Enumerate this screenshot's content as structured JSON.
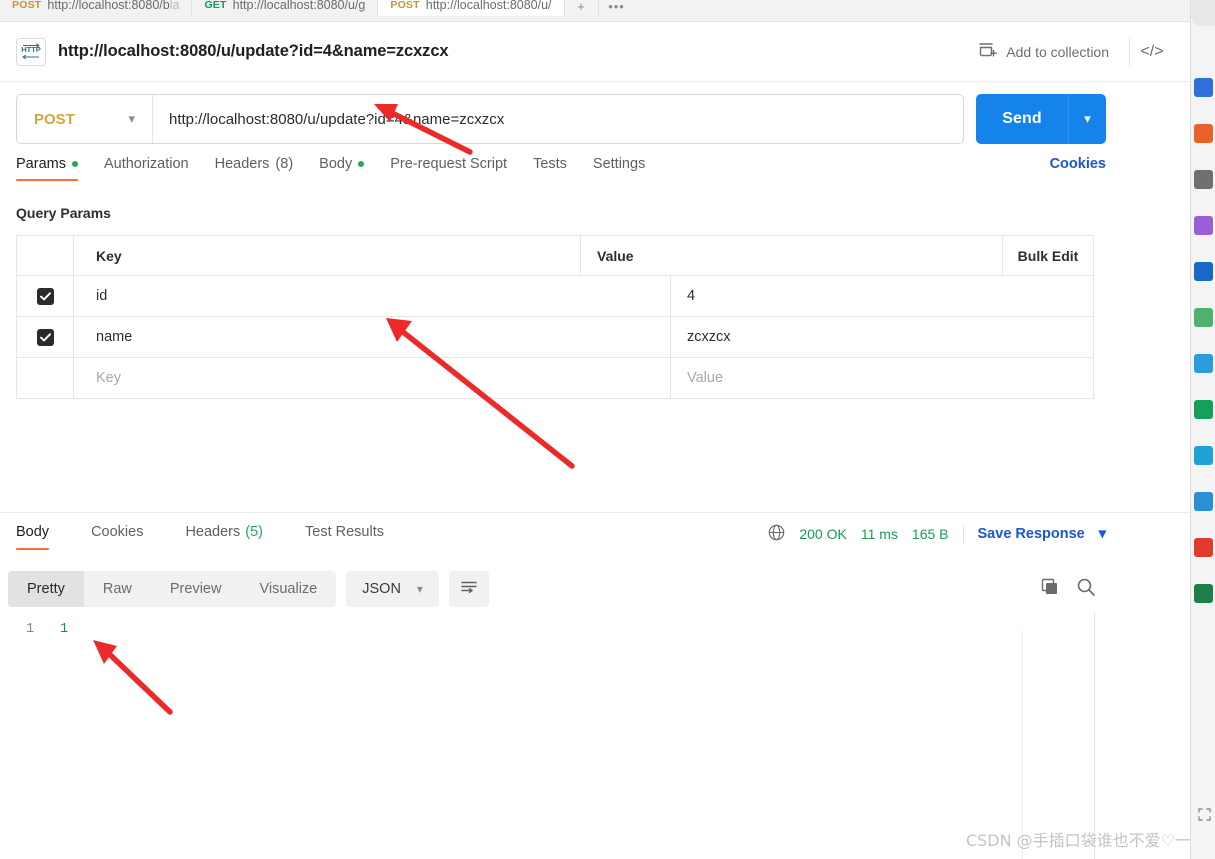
{
  "window_tabs": [
    {
      "method": "POST",
      "url": "http://localhost:8080/b",
      "url_faded": "la",
      "active": false
    },
    {
      "method": "GET",
      "url": "http://localhost:8080/u/g",
      "url_faded": "",
      "active": false
    },
    {
      "method": "POST",
      "url": "http://localhost:8080/u/",
      "url_faded": "",
      "active": true
    }
  ],
  "tab_controls": {
    "plus": "+",
    "more": "•••"
  },
  "request": {
    "icon_label": "HTTP",
    "title": "http://localhost:8080/u/update?id=4&name=zcxzcx",
    "add_to_collection": "Add to collection",
    "code_icon": "</>",
    "method": "POST",
    "url": "http://localhost:8080/u/update?id=4&name=zcxzcx",
    "send_label": "Send"
  },
  "request_tabs": [
    {
      "label": "Params",
      "dot": true,
      "count": "",
      "active": true
    },
    {
      "label": "Authorization",
      "dot": false,
      "count": "",
      "active": false
    },
    {
      "label": "Headers",
      "dot": false,
      "count": "(8)",
      "active": false
    },
    {
      "label": "Body",
      "dot": true,
      "count": "",
      "active": false
    },
    {
      "label": "Pre-request Script",
      "dot": false,
      "count": "",
      "active": false
    },
    {
      "label": "Tests",
      "dot": false,
      "count": "",
      "active": false
    },
    {
      "label": "Settings",
      "dot": false,
      "count": "",
      "active": false
    }
  ],
  "cookies_link": "Cookies",
  "query_params": {
    "section_label": "Query Params",
    "headers": {
      "key": "Key",
      "value": "Value",
      "bulk": "Bulk Edit"
    },
    "rows": [
      {
        "checked": true,
        "key": "id",
        "value": "4",
        "placeholder": false
      },
      {
        "checked": true,
        "key": "name",
        "value": "zcxzcx",
        "placeholder": false
      },
      {
        "checked": false,
        "key": "Key",
        "value": "Value",
        "placeholder": true
      }
    ]
  },
  "response": {
    "tabs": [
      {
        "label": "Body",
        "count": "",
        "active": true
      },
      {
        "label": "Cookies",
        "count": "",
        "active": false
      },
      {
        "label": "Headers",
        "count": "(5)",
        "active": false
      },
      {
        "label": "Test Results",
        "count": "",
        "active": false
      }
    ],
    "status": "200 OK",
    "time": "11 ms",
    "size": "165 B",
    "save_label": "Save Response",
    "view_modes": [
      "Pretty",
      "Raw",
      "Preview",
      "Visualize"
    ],
    "active_view": "Pretty",
    "format": "JSON",
    "body_lines": [
      {
        "num": "1",
        "text": "1"
      }
    ]
  },
  "colors": {
    "accent_orange": "#ff6c37",
    "send_blue": "#1483ea",
    "link_blue": "#1a56d6",
    "status_green": "#1a9a53",
    "method_post": "#d9a33c",
    "method_get": "#0f9d58",
    "arrow_red": "#ec2a2a"
  },
  "watermark": "CSDN @手插口袋谁也不爱♡一"
}
